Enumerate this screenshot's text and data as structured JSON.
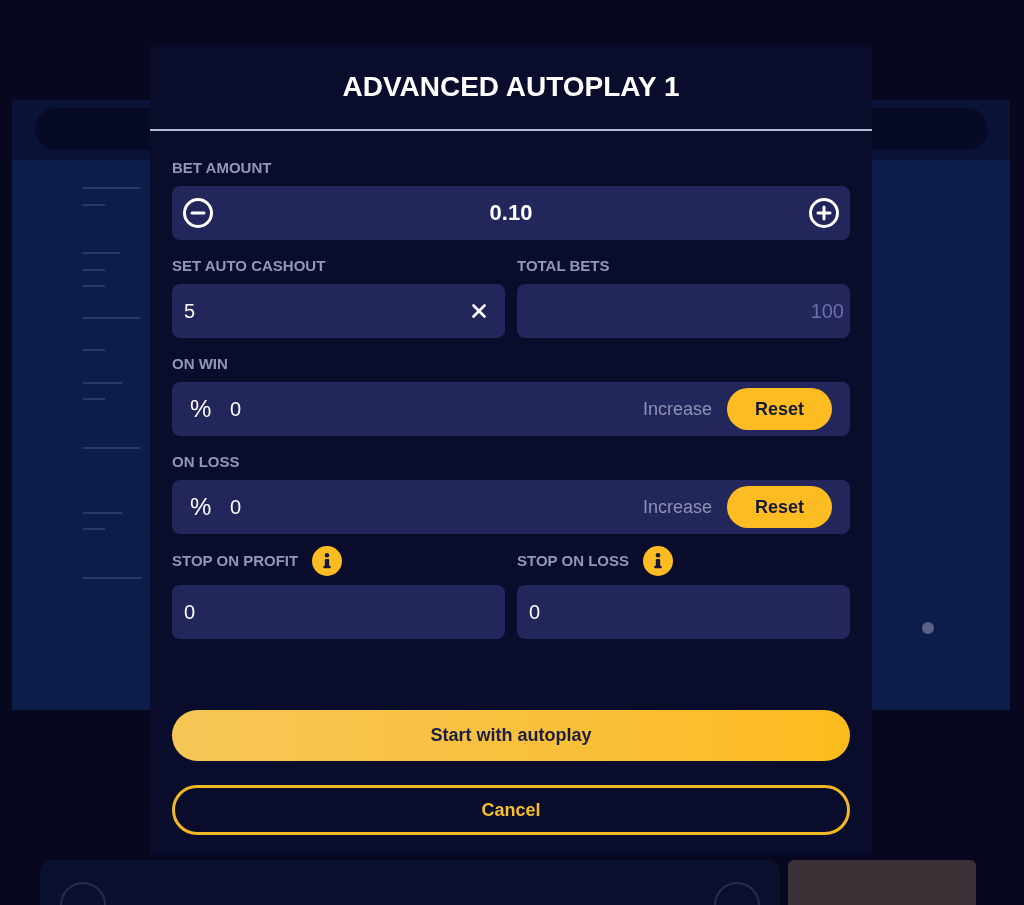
{
  "dialog": {
    "title": "ADVANCED AUTOPLAY 1"
  },
  "bet_amount": {
    "label": "BET AMOUNT",
    "value": "0.10"
  },
  "auto_cashout": {
    "label": "SET AUTO CASHOUT",
    "value": "5"
  },
  "total_bets": {
    "label": "TOTAL BETS",
    "placeholder": "100"
  },
  "adjustments": [
    {
      "label": "ON WIN",
      "symbol": "%",
      "value": "0",
      "options": [
        {
          "label": "Increase",
          "selected": false
        },
        {
          "label": "Reset",
          "selected": true
        }
      ]
    },
    {
      "label": "ON LOSS",
      "symbol": "%",
      "value": "0",
      "options": [
        {
          "label": "Increase",
          "selected": false
        },
        {
          "label": "Reset",
          "selected": true
        }
      ]
    }
  ],
  "stop_limits": [
    {
      "label": "STOP ON PROFIT",
      "value": "0"
    },
    {
      "label": "STOP ON LOSS",
      "value": "0"
    }
  ],
  "actions": [
    {
      "kind": "primary",
      "label": "Start with autoplay"
    },
    {
      "kind": "outline",
      "label": "Cancel"
    }
  ]
}
